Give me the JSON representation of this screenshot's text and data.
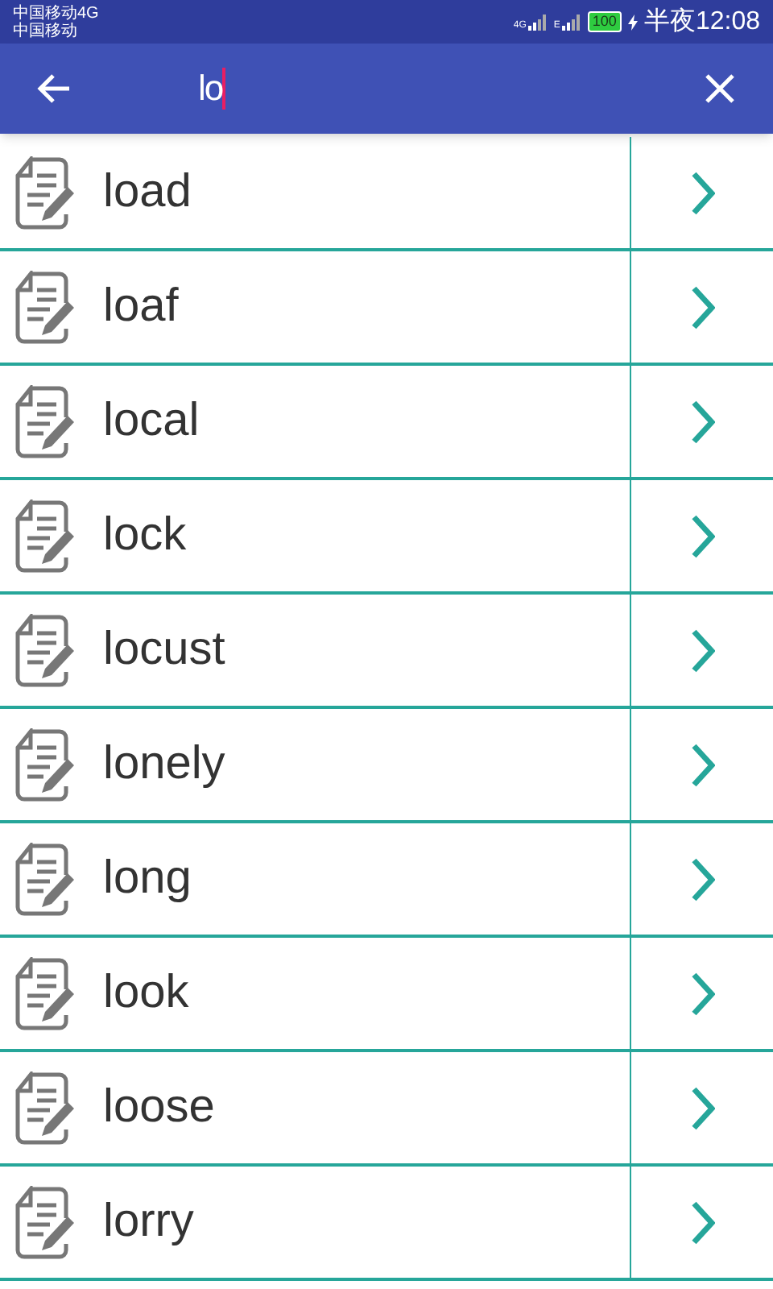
{
  "status_bar": {
    "carriers": [
      "中国移动4G",
      "中国移动"
    ],
    "network_1": "4G",
    "network_2": "E",
    "battery": "100",
    "time": "半夜12:08"
  },
  "search": {
    "value": "lo"
  },
  "results": [
    {
      "word": "load"
    },
    {
      "word": "loaf"
    },
    {
      "word": "local"
    },
    {
      "word": "lock"
    },
    {
      "word": "locust"
    },
    {
      "word": "lonely"
    },
    {
      "word": "long"
    },
    {
      "word": "look"
    },
    {
      "word": "loose"
    },
    {
      "word": "lorry"
    }
  ]
}
